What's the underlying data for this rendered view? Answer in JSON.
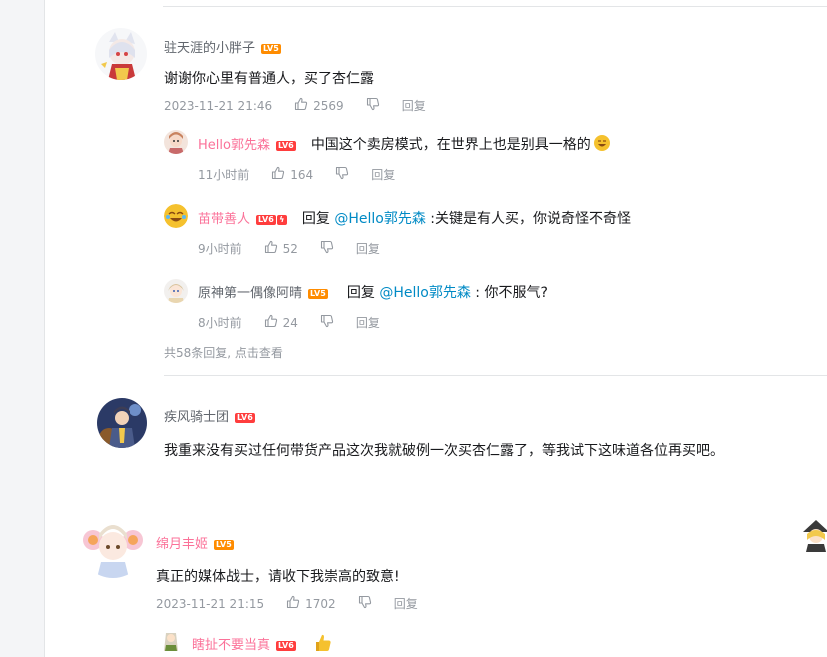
{
  "comments": [
    {
      "user": "驻天涯的小胖子",
      "level": "LV5",
      "text": "谢谢你心里有普通人，买了杏仁露",
      "time": "2023-11-21 21:46",
      "likes": "2569",
      "reply_label": "回复",
      "replies": [
        {
          "user": "Hello郭先森",
          "level": "LV6",
          "text": "中国这个卖房模式，在世界上也是别具一格的",
          "emoji": "grinning-emoji",
          "time": "11小时前",
          "likes": "164",
          "reply_label": "回复"
        },
        {
          "user": "苗带善人",
          "level": "LV6",
          "reply_word": "回复",
          "mention": "@Hello郭先森",
          "text": ":关键是有人买，你说奇怪不奇怪",
          "time": "9小时前",
          "likes": "52",
          "reply_label": "回复"
        },
        {
          "user": "原神第一偶像阿晴",
          "level": "LV5",
          "reply_word": "回复",
          "mention": "@Hello郭先森",
          "text": ": 你不服气?",
          "time": "8小时前",
          "likes": "24",
          "reply_label": "回复"
        }
      ],
      "more_replies": "共58条回复, 点击查看"
    },
    {
      "user": "疾风骑士团",
      "level": "LV6",
      "text": "我重来没有买过任何带货产品这次我就破例一次买杏仁露了，等我试下这味道各位再买吧。"
    },
    {
      "user": "绵月丰姬",
      "level": "LV5",
      "text": "真正的媒体战士，请收下我崇高的致意!",
      "time": "2023-11-21 21:15",
      "likes": "1702",
      "reply_label": "回复",
      "replies": [
        {
          "user": "瞎扯不要当真",
          "level": "LV6",
          "emoji": "thumbs-up-emoji"
        }
      ]
    }
  ],
  "colors": {
    "pink_name": "#fb7299",
    "gray_name": "#61666d",
    "mention": "#008ac5",
    "meta": "#9499a0",
    "lv5": "#ff8c00",
    "lv6": "#ff3d3d"
  }
}
